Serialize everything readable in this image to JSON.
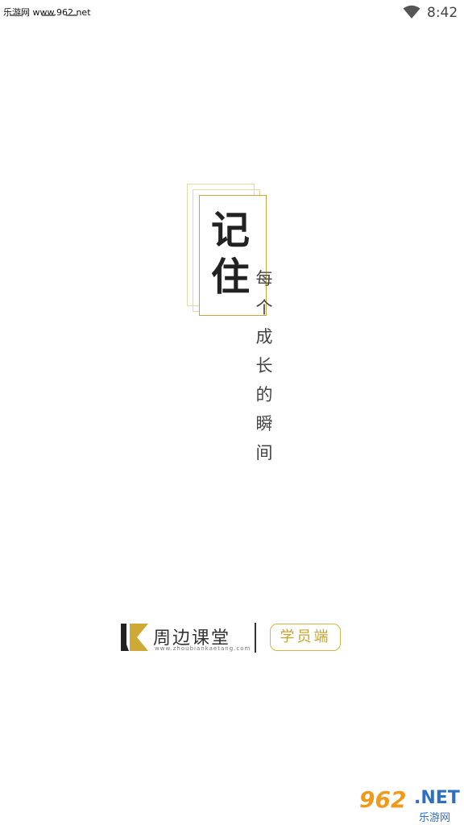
{
  "status_bar": {
    "source_text": "乐游网 www.962.net",
    "time": "8:42",
    "wifi_icon": "wifi-icon"
  },
  "slogan": {
    "big": [
      "记",
      "住"
    ],
    "small": [
      "每",
      "个",
      "成",
      "长",
      "的",
      "瞬",
      "间"
    ]
  },
  "brand": {
    "name": "周边课堂",
    "url": "www.zhoubiankaetang.com",
    "badge": "学员端",
    "logo_icon": "k-logo-icon",
    "accent_color": "#c9a42d"
  },
  "watermark": {
    "number": "962",
    "suffix": ".NET",
    "subtitle": "乐游网"
  }
}
